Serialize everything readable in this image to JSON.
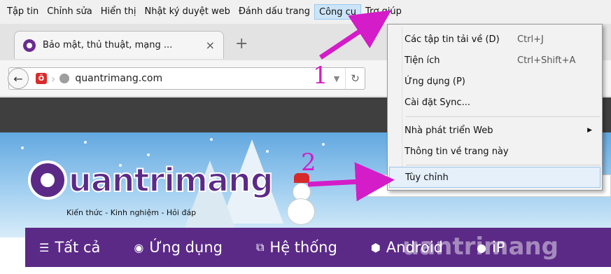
{
  "menubar": {
    "items": [
      {
        "label": "Tập tin"
      },
      {
        "label": "Chỉnh sửa"
      },
      {
        "label": "Hiển thị"
      },
      {
        "label": "Nhật ký duyệt web"
      },
      {
        "label": "Đánh dấu trang"
      },
      {
        "label": "Công cụ",
        "active": true
      },
      {
        "label": "Trợ giúp"
      }
    ]
  },
  "tab": {
    "title": "Bảo mật, thủ thuật, mạng ...",
    "close_glyph": "×",
    "new_tab_glyph": "+"
  },
  "navbar": {
    "url": "quantrimang.com"
  },
  "dropdown": {
    "items": [
      {
        "label": "Các tập tin tải về (D)",
        "shortcut": "Ctrl+J"
      },
      {
        "label": "Tiện ích",
        "shortcut": "Ctrl+Shift+A"
      },
      {
        "label": "Ứng dụng (P)",
        "shortcut": ""
      },
      {
        "label": "Cài đặt Sync...",
        "shortcut": ""
      },
      {
        "label": "Nhà phát triển Web",
        "shortcut": "",
        "submenu": true
      },
      {
        "label": "Thông tin về trang này",
        "shortcut": ""
      },
      {
        "label": "Tùy chỉnh",
        "shortcut": "",
        "highlighted": true
      }
    ]
  },
  "site": {
    "logo_text": "uantrimang",
    "tagline": "Kiến thức - Kinh nghiệm - Hỏi đáp",
    "nav": [
      {
        "label": "Tất cả",
        "icon": "menu-icon"
      },
      {
        "label": "Ứng dụng",
        "icon": "app-icon"
      },
      {
        "label": "Hệ thống",
        "icon": "network-icon"
      },
      {
        "label": "Android",
        "icon": "android-icon"
      },
      {
        "label": "iP",
        "icon": "apple-icon"
      }
    ],
    "watermark": "uantrimang"
  },
  "annotations": {
    "step1": "1",
    "step2": "2",
    "color": "#d41cc8"
  }
}
